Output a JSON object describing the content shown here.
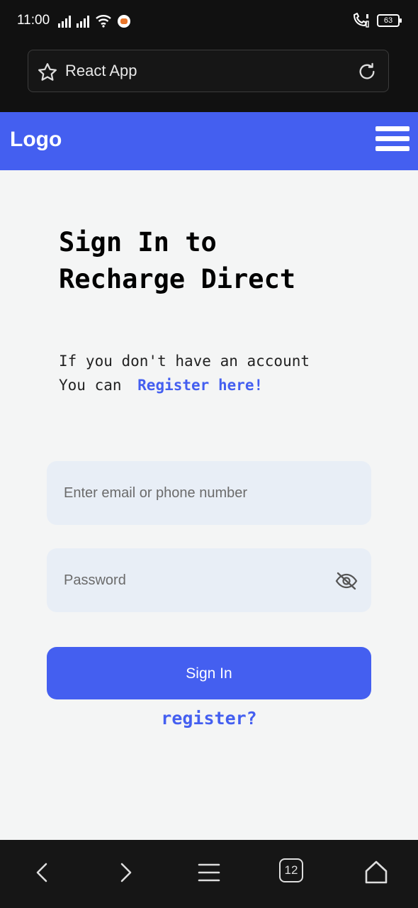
{
  "status_bar": {
    "time": "11:00",
    "battery": "63"
  },
  "browser": {
    "tab_title": "React App",
    "tabs_count": "12"
  },
  "navbar": {
    "logo": "Logo"
  },
  "signin": {
    "heading_line1": "Sign In to",
    "heading_line2": "Recharge Direct",
    "subtext_line1": "If you don't have an account",
    "subtext_line2": "You can ",
    "register_here": "Register here!",
    "email_placeholder": "Enter email or phone number",
    "password_placeholder": "Password",
    "signin_button": "Sign In",
    "register_link": "register?"
  },
  "colors": {
    "accent": "#445ff0",
    "input_bg": "#e8eef6",
    "page_bg": "#f4f5f5"
  },
  "icons": [
    "star-icon",
    "reload-icon",
    "menu-icon",
    "eye-off-icon",
    "back-icon",
    "forward-icon",
    "tabs-icon",
    "home-icon"
  ]
}
